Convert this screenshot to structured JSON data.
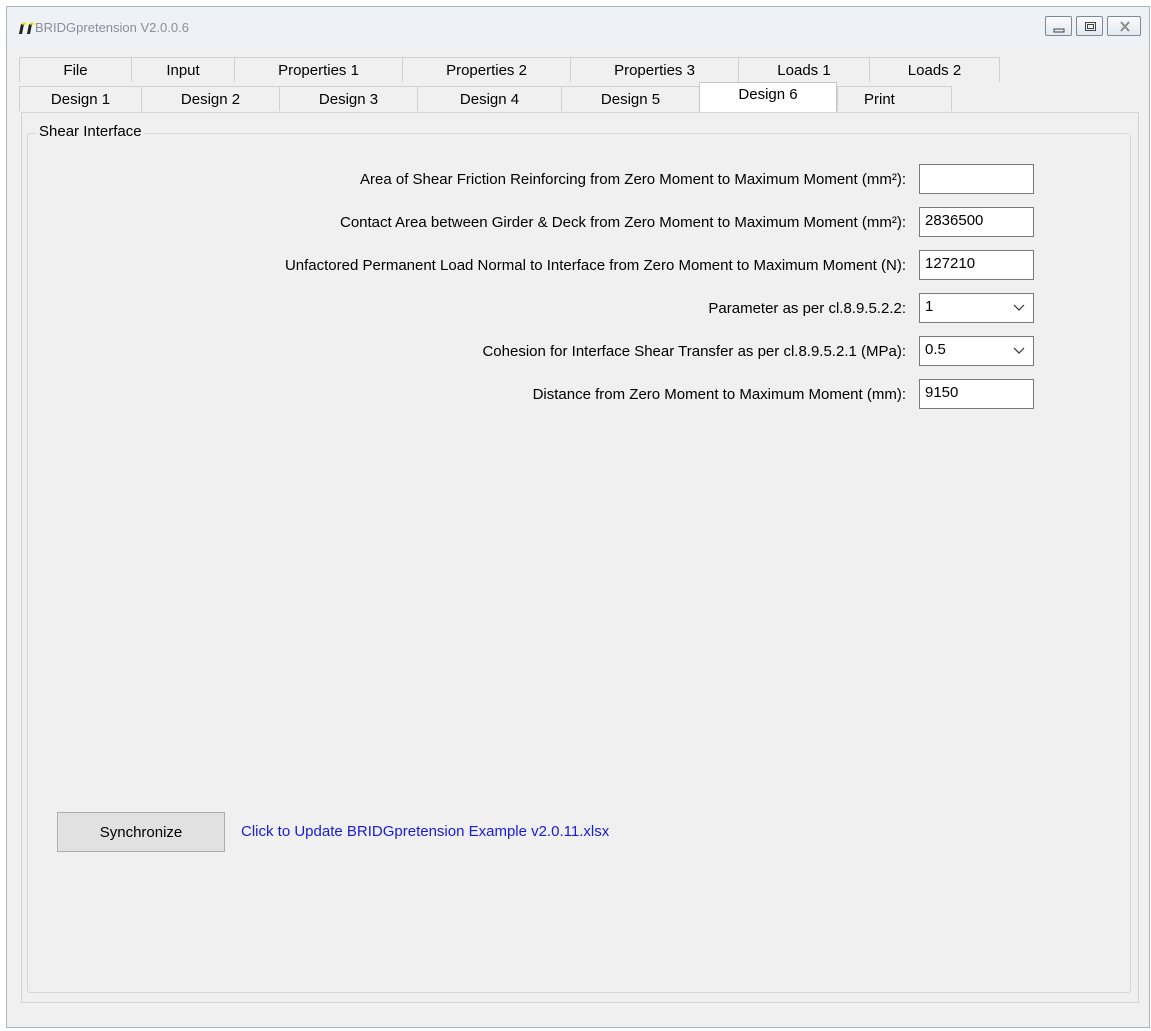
{
  "window": {
    "title": "BRIDGpretension V2.0.0.6"
  },
  "tabs_row1": [
    {
      "label": "File"
    },
    {
      "label": "Input"
    },
    {
      "label": "Properties 1"
    },
    {
      "label": "Properties 2"
    },
    {
      "label": "Properties 3"
    },
    {
      "label": "Loads 1"
    },
    {
      "label": "Loads 2"
    }
  ],
  "tabs_row2": [
    {
      "label": "Design 1"
    },
    {
      "label": "Design 2"
    },
    {
      "label": "Design 3"
    },
    {
      "label": "Design 4"
    },
    {
      "label": "Design 5"
    },
    {
      "label": "Design 6",
      "active": true
    },
    {
      "label": "Print"
    }
  ],
  "group": {
    "title": "Shear Interface"
  },
  "fields": [
    {
      "label": "Area of Shear Friction Reinforcing from Zero Moment to Maximum Moment (mm²):",
      "value": ""
    },
    {
      "label": "Contact Area between Girder & Deck from Zero Moment to Maximum Moment (mm²):",
      "value": "2836500"
    },
    {
      "label": "Unfactored Permanent Load Normal to Interface from Zero Moment to Maximum Moment (N):",
      "value": "127210"
    },
    {
      "label": "Parameter as per cl.8.9.5.2.2:",
      "value": "1",
      "type": "dropdown"
    },
    {
      "label": "Cohesion for Interface Shear Transfer as per cl.8.9.5.2.1 (MPa):",
      "value": "0.5",
      "type": "dropdown"
    },
    {
      "label": "Distance from Zero Moment to Maximum Moment (mm):",
      "value": "9150"
    }
  ],
  "sync": {
    "button_label": "Synchronize",
    "link_text": "Click to Update BRIDGpretension Example v2.0.11.xlsx"
  },
  "colors": {
    "link": "#1a1adb",
    "app_icon": "#f2e200"
  },
  "icons": [
    "app-icon",
    "minimize-icon",
    "restore-icon",
    "close-icon",
    "chevron-down-icon"
  ]
}
